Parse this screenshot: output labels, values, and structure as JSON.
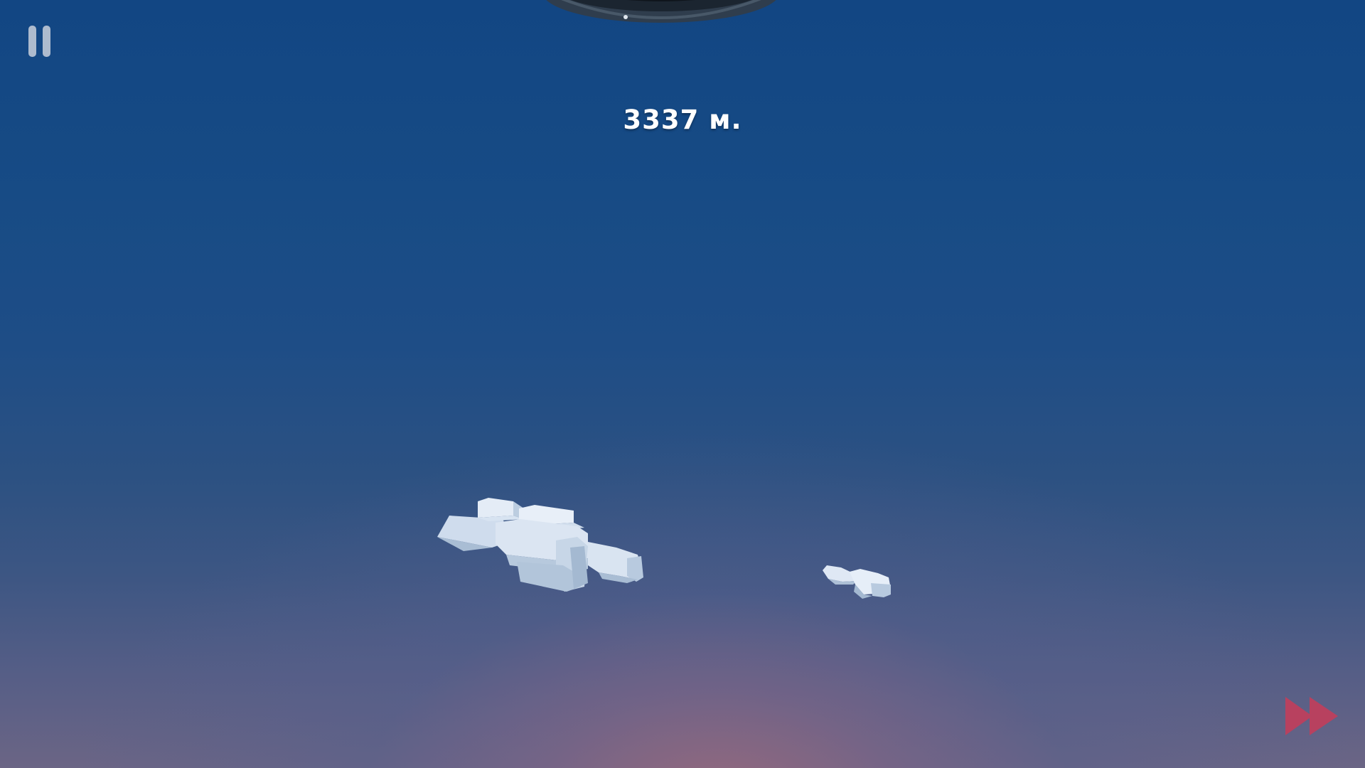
{
  "hud": {
    "distance_label": "3337 м.",
    "pause_icon": "pause-icon",
    "fast_forward_icon": "fast-forward-icon"
  },
  "colors": {
    "sky_top": "#124683",
    "sky_bottom_glow": "#8f6b80",
    "hud_text": "#ffffff",
    "pause_icon": "#c9d0dc",
    "fast_forward_icon": "#b8415f",
    "cloud_light": "#e4ecf6",
    "cloud_shade": "#a9bdd4"
  }
}
